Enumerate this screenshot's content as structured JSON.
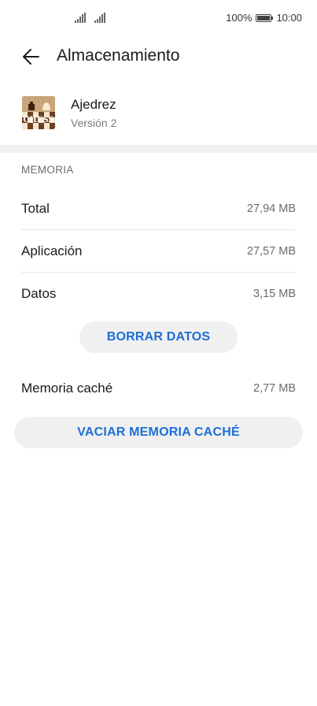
{
  "status_bar": {
    "battery_percent": "100%",
    "time": "10:00"
  },
  "header": {
    "title": "Almacenamiento"
  },
  "app": {
    "name": "Ajedrez",
    "version": "Versión 2",
    "icon_text": "CHESS"
  },
  "memory": {
    "section_title": "MEMORIA",
    "rows": [
      {
        "label": "Total",
        "value": "27,94 MB"
      },
      {
        "label": "Aplicación",
        "value": "27,57 MB"
      },
      {
        "label": "Datos",
        "value": "3,15 MB"
      }
    ],
    "clear_data_label": "BORRAR DATOS",
    "cache_label": "Memoria caché",
    "cache_value": "2,77 MB",
    "clear_cache_label": "VACIAR MEMORIA CACHÉ"
  },
  "colors": {
    "accent": "#1c6fd8",
    "button_bg": "#f0f0f0",
    "divider_band": "#f1f1f1"
  }
}
